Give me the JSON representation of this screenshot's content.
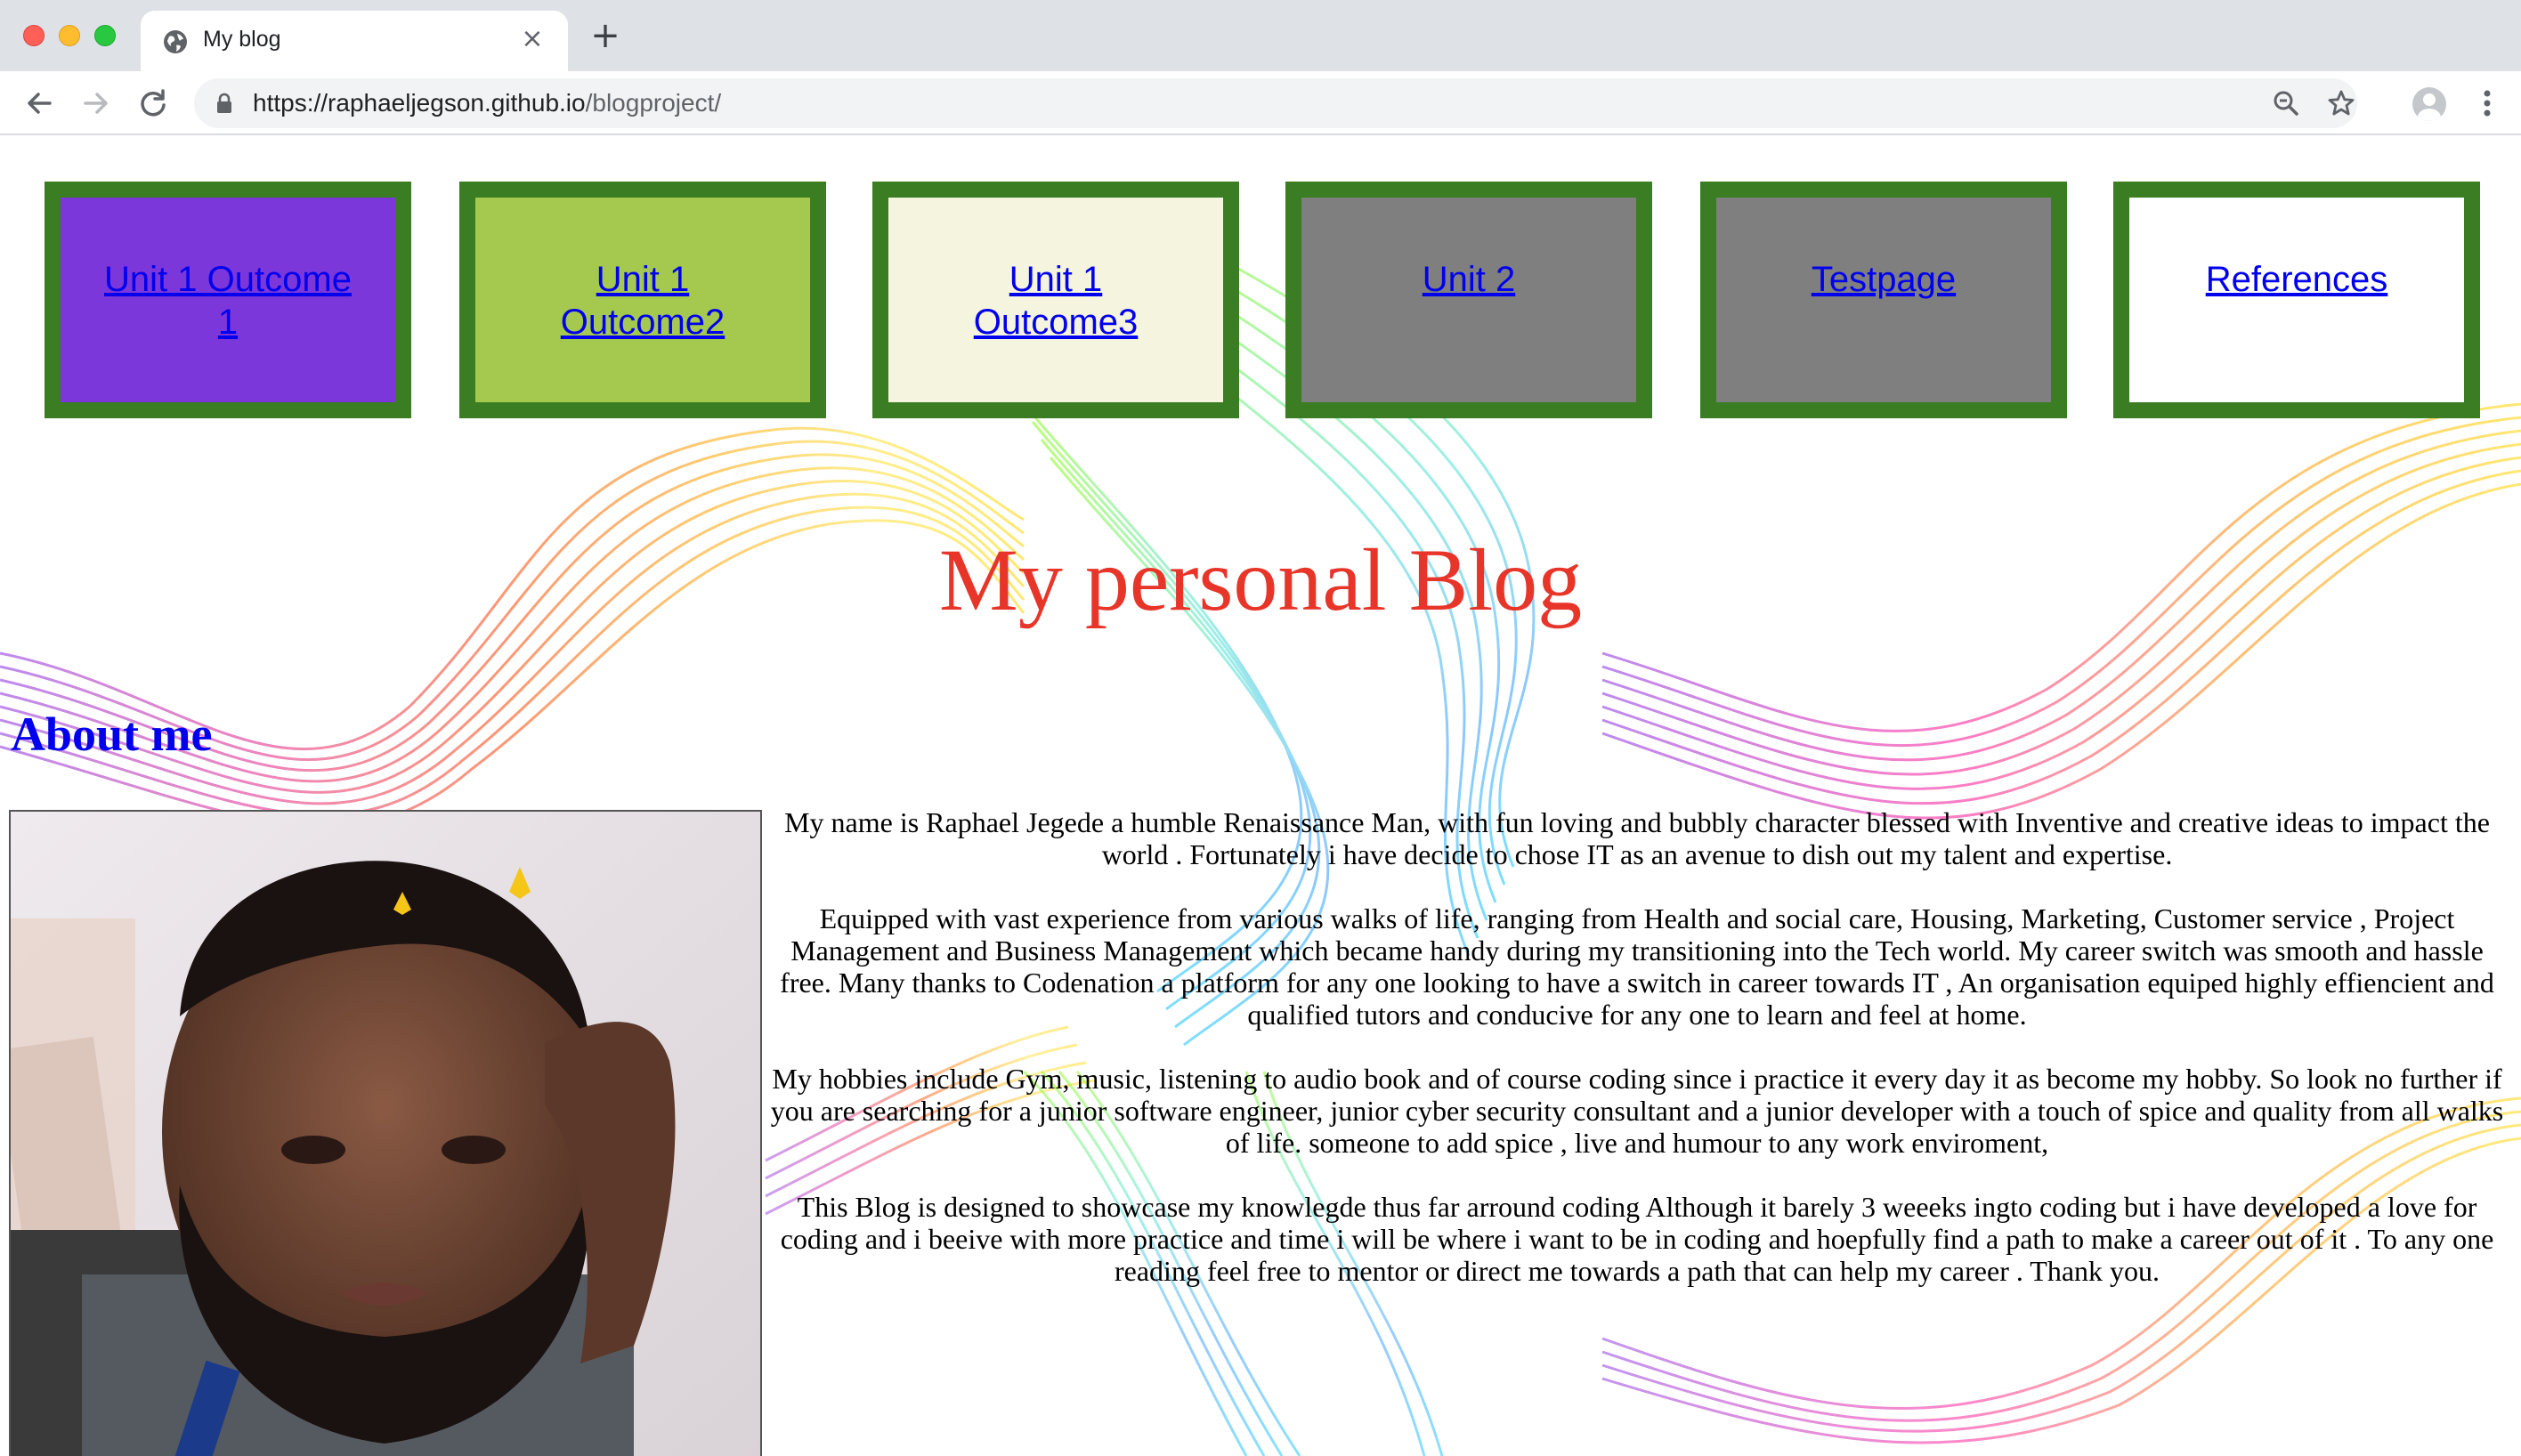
{
  "browser": {
    "tab_title": "My blog",
    "new_tab_symbol": "+",
    "close_symbol": "×",
    "url_domain": "https://raphaeljegson.github.io",
    "url_path": "/blogproject/"
  },
  "nav": {
    "items": [
      {
        "label": "Unit 1 Outcome 1",
        "bg": "#7b37d9"
      },
      {
        "label": "Unit 1 Outcome2",
        "bg": "#a4c94e"
      },
      {
        "label": "Unit 1 Outcome3",
        "bg": "#f4f4df"
      },
      {
        "label": "Unit 2",
        "bg": "#7f7f7f"
      },
      {
        "label": "Testpage",
        "bg": "#7f7f7f"
      },
      {
        "label": "References",
        "bg": "#ffffff"
      }
    ],
    "border_color": "#3a7d23"
  },
  "page": {
    "title": "My personal Blog",
    "about_heading": "About me",
    "paragraphs": [
      "My name is Raphael Jegede a humble Renaissance Man, with fun loving and bubbly character blessed with Inventive and creative ideas to impact the world . Fortunately i have decide to chose IT as an avenue to dish out my talent and expertise.",
      "Equipped with vast experience from various walks of life, ranging from Health and social care, Housing, Marketing, Customer service , Project Management and Business Management which became handy during my transitioning into the Tech world. My career switch was smooth and hassle free. Many thanks to Codenation a platform for any one looking to have a switch in career towards IT , An organisation equiped highly effiencient and qualified tutors and conducive for any one to learn and feel at home.",
      "My hobbies include Gym, music, listening to audio book and of course coding since i practice it every day it as become my hobby. So look no further if you are searching for a junior software engineer, junior cyber security consultant and a junior developer with a touch of spice and quality from all walks of life. someone to add spice , live and humour to any work enviroment,",
      "This Blog is designed to showcase my knowlegde thus far arround coding Although it barely 3 weeeks ingto coding but i have developed a love for coding and i beeive with more practice and time i will be where i want to be in coding and hoepfully find a path to make a career out of it . To any one reading feel free to mentor or direct me towards a path that can help my career . Thank you."
    ],
    "colors": {
      "title": "#e8352a",
      "heading": "#0000ee",
      "link": "#0000ee"
    }
  },
  "icons": {
    "favicon": "globe-icon",
    "back": "arrow-left-icon",
    "forward": "arrow-right-icon",
    "reload": "reload-icon",
    "lock": "lock-icon",
    "zoom": "zoom-icon",
    "bookmark": "star-icon",
    "profile": "profile-icon",
    "menu": "kebab-menu-icon"
  }
}
